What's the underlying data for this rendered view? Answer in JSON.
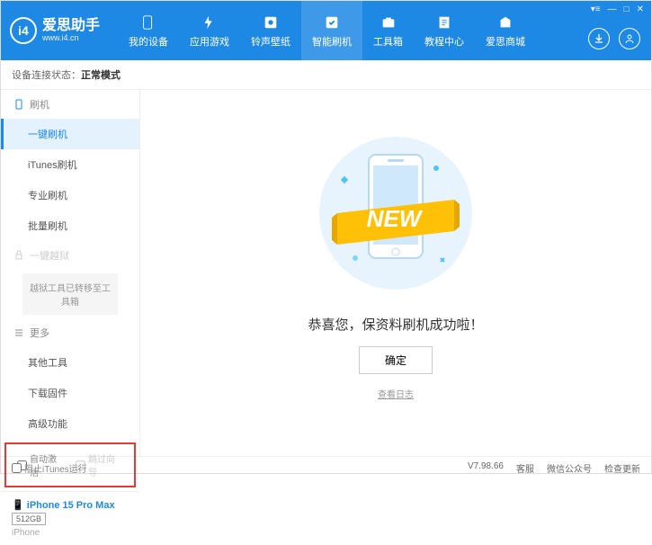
{
  "app": {
    "title": "爱思助手",
    "url": "www.i4.cn"
  },
  "nav": [
    {
      "label": "我的设备"
    },
    {
      "label": "应用游戏"
    },
    {
      "label": "铃声壁纸"
    },
    {
      "label": "智能刷机",
      "active": true
    },
    {
      "label": "工具箱"
    },
    {
      "label": "教程中心"
    },
    {
      "label": "爱思商城"
    }
  ],
  "status": {
    "prefix": "设备连接状态：",
    "mode": "正常模式"
  },
  "sidebar": {
    "flash_section": "刷机",
    "items": [
      {
        "label": "一键刷机",
        "active": true
      },
      {
        "label": "iTunes刷机"
      },
      {
        "label": "专业刷机"
      },
      {
        "label": "批量刷机"
      }
    ],
    "jailbreak_section": "一键越狱",
    "jailbreak_note": "越狱工具已转移至工具箱",
    "more_section": "更多",
    "more": [
      {
        "label": "其他工具"
      },
      {
        "label": "下载固件"
      },
      {
        "label": "高级功能"
      }
    ],
    "auto_activate": "自动激活",
    "skip_guide": "跳过向导"
  },
  "device": {
    "name": "iPhone 15 Pro Max",
    "storage": "512GB",
    "type": "iPhone",
    "icon": "📱"
  },
  "main": {
    "banner": "NEW",
    "success": "恭喜您，保资料刷机成功啦！",
    "ok": "确定",
    "log": "查看日志"
  },
  "footer": {
    "block_itunes": "阻止iTunes运行",
    "version": "V7.98.66",
    "links": [
      "客服",
      "微信公众号",
      "检查更新"
    ]
  }
}
